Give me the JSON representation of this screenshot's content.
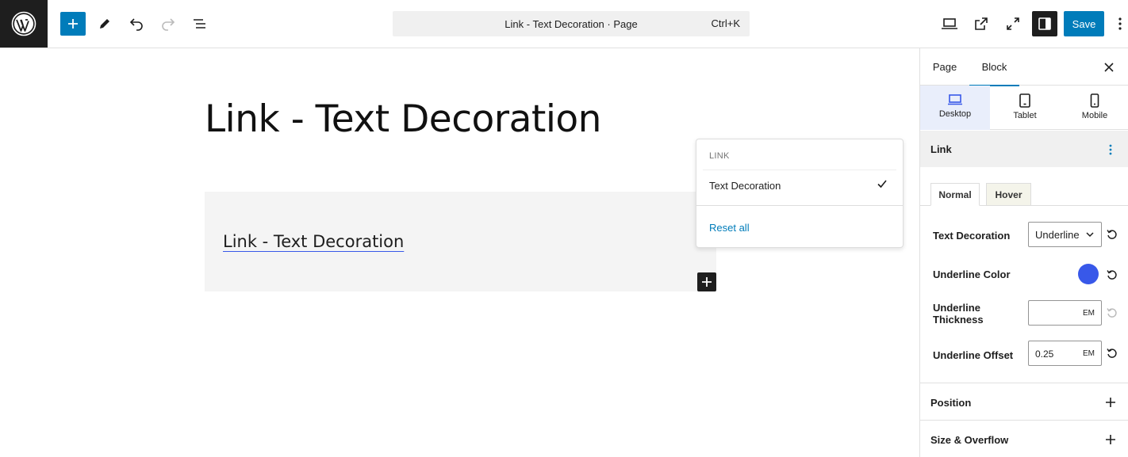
{
  "topbar": {
    "command_title": "Link - Text Decoration · Page",
    "command_shortcut": "Ctrl+K",
    "save_label": "Save"
  },
  "canvas": {
    "page_title": "Link - Text Decoration",
    "group_link_text": "Link - Text Decoration"
  },
  "popover": {
    "heading": "LINK",
    "item_label": "Text Decoration",
    "reset_label": "Reset all"
  },
  "sidebar": {
    "tabs": [
      {
        "label": "Page"
      },
      {
        "label": "Block"
      }
    ],
    "devices": [
      {
        "label": "Desktop"
      },
      {
        "label": "Tablet"
      },
      {
        "label": "Mobile"
      }
    ],
    "panel_title": "Link",
    "states": [
      {
        "label": "Normal"
      },
      {
        "label": "Hover"
      }
    ],
    "controls": {
      "text_decoration_label": "Text Decoration",
      "text_decoration_value": "Underline",
      "underline_color_label": "Underline Color",
      "underline_color": "#3858e9",
      "thickness_label": "Underline Thickness",
      "thickness_value": "",
      "thickness_unit": "EM",
      "offset_label": "Underline Offset",
      "offset_value": "0.25",
      "offset_unit": "EM"
    },
    "sections": [
      {
        "label": "Position"
      },
      {
        "label": "Size & Overflow"
      }
    ]
  },
  "colors": {
    "accent": "#007cba",
    "dark": "#1e1e1e",
    "underline": "#3858e9"
  }
}
